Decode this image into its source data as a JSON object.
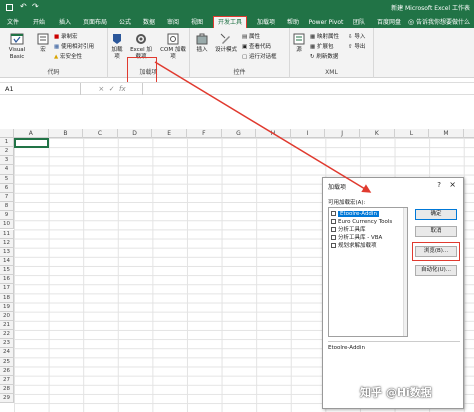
{
  "window": {
    "title": "新建 Microsoft Excel 工作表"
  },
  "tabs": [
    {
      "label": "文件"
    },
    {
      "label": "开始"
    },
    {
      "label": "插入"
    },
    {
      "label": "页面布局"
    },
    {
      "label": "公式"
    },
    {
      "label": "数据"
    },
    {
      "label": "审阅"
    },
    {
      "label": "视图"
    },
    {
      "label": "开发工具"
    },
    {
      "label": "加载项"
    },
    {
      "label": "帮助"
    },
    {
      "label": "Power Pivot"
    },
    {
      "label": "团队"
    },
    {
      "label": "百度网盘"
    }
  ],
  "tell_me": "告诉我你想要做什么",
  "ribbon": {
    "code": {
      "label": "代码",
      "visual_basic": "Visual Basic",
      "macros": "宏",
      "record_macro": "录制宏",
      "relative_ref": "使用相对引用",
      "macro_security": "宏安全性"
    },
    "addins": {
      "label": "加载项",
      "addins_btn": "加载项",
      "excel_addins": "Excel 加载项",
      "com_addins": "COM 加载项"
    },
    "controls": {
      "label": "控件",
      "insert": "插入",
      "design_mode": "设计模式",
      "properties": "属性",
      "view_code": "查看代码",
      "run_dialog": "运行对话框"
    },
    "xml": {
      "label": "XML",
      "source": "源",
      "map_props": "映射属性",
      "expansion_packs": "扩展包",
      "refresh_data": "刷新数据",
      "import": "导入",
      "export": "导出"
    }
  },
  "formula_bar": {
    "name_box": "A1",
    "fx": "fx"
  },
  "columns": [
    "A",
    "B",
    "C",
    "D",
    "E",
    "F",
    "G",
    "H",
    "I",
    "J",
    "K",
    "L",
    "M"
  ],
  "rows": [
    "1",
    "2",
    "3",
    "4",
    "5",
    "6",
    "7",
    "8",
    "9",
    "10",
    "11",
    "12",
    "13",
    "14",
    "15",
    "16",
    "17",
    "18",
    "19",
    "20",
    "21",
    "22",
    "23",
    "24",
    "25",
    "26",
    "27",
    "28",
    "29"
  ],
  "dialog": {
    "title": "加载项",
    "help": "?",
    "close": "×",
    "available_label": "可用加载宏(A):",
    "items": [
      {
        "label": "Etoolre-Addin",
        "checked": false,
        "highlighted": true
      },
      {
        "label": "Euro Currency Tools",
        "checked": false,
        "highlighted": false
      },
      {
        "label": "分析工具库",
        "checked": false,
        "highlighted": false
      },
      {
        "label": "分析工具库 - VBA",
        "checked": false,
        "highlighted": false
      },
      {
        "label": "规划求解加载项",
        "checked": false,
        "highlighted": false
      }
    ],
    "ok": "确定",
    "cancel": "取消",
    "browse": "浏览(B)...",
    "automation": "自动化(U)...",
    "description": "Etoolre-Addin"
  },
  "watermark": "知乎 @Hi数据",
  "colors": {
    "accent": "#217346",
    "highlight_box": "#e03a2f",
    "selection": "#0078d7"
  }
}
